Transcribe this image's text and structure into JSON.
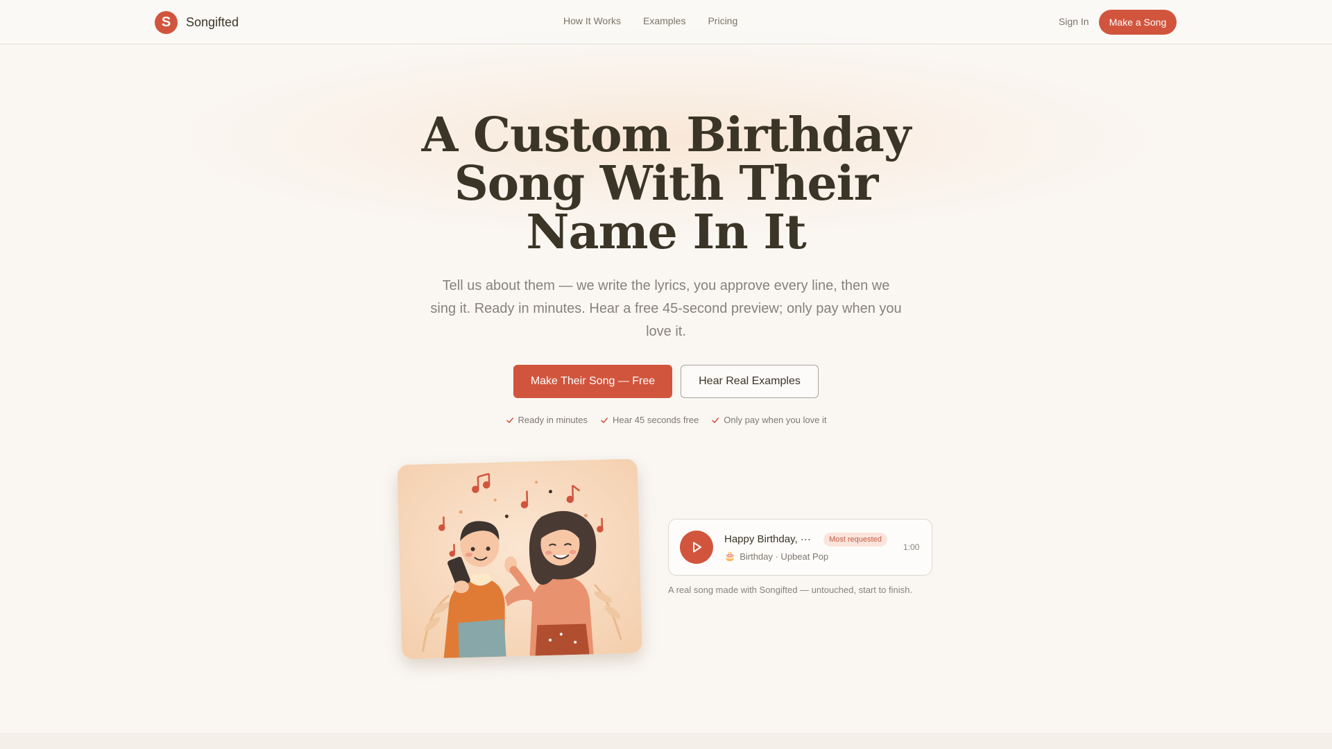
{
  "nav": {
    "brand_initial": "S",
    "brand_name": "Songifted",
    "links": [
      "How It Works",
      "Examples",
      "Pricing"
    ],
    "sign_in": "Sign In",
    "cta": "Make a Song"
  },
  "hero": {
    "title_lines": [
      "A Custom Birthday",
      "Song With Their",
      "Name In It"
    ],
    "subtitle": "Tell us about them — we write the lyrics, you approve every line, then we sing it. Ready in minutes. Hear a free 45-second preview; only pay when you love it.",
    "primary_button": "Make Their Song — Free",
    "secondary_button": "Hear Real Examples",
    "checks": [
      "Ready in minutes",
      "Hear 45 seconds free",
      "Only pay when you love it"
    ]
  },
  "player": {
    "title": "Happy Birthday, ···",
    "badge": "Most requested",
    "meta": "Birthday · Upbeat Pop",
    "meta_icon": "cake-icon",
    "duration": "1:00",
    "play_icon": "play-icon"
  },
  "caption": "A real song made with Songifted — untouched, start to finish.",
  "colors": {
    "accent": "#d1553d",
    "background": "#faf7f3",
    "text": "#3a3526"
  }
}
